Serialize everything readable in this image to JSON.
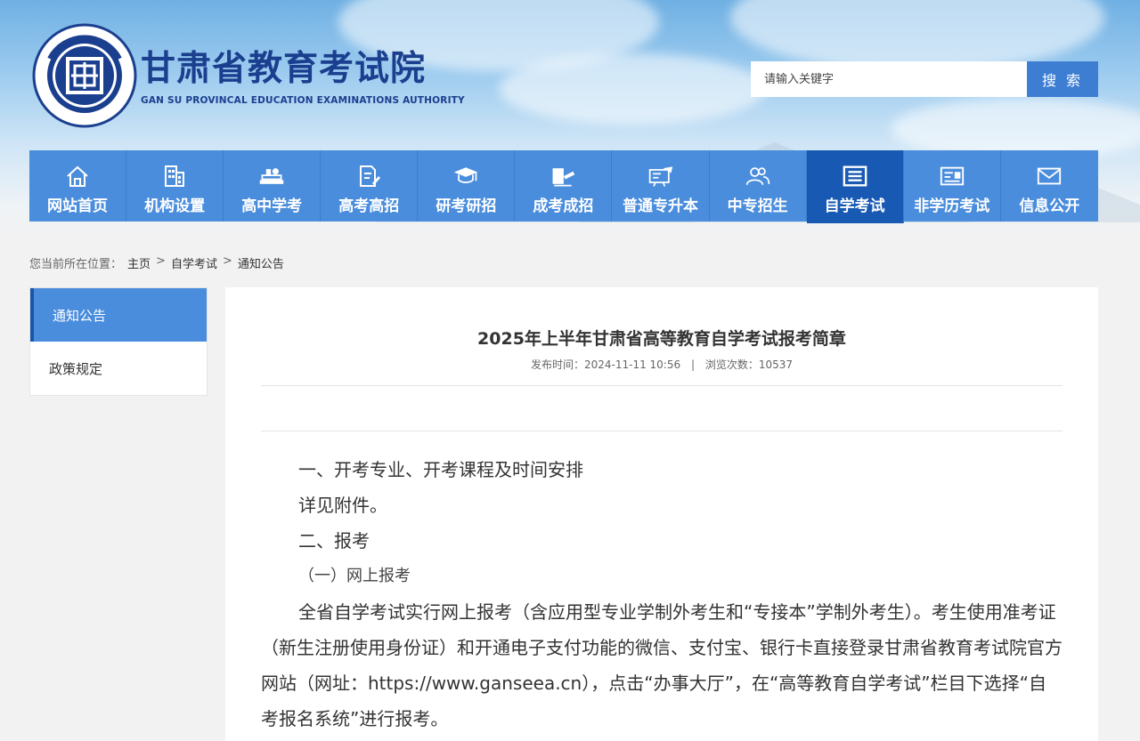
{
  "header": {
    "logo_text": "甘肃省教育考试院",
    "title_cn": "甘肃省教育考试院",
    "title_en": "GAN SU PROVINCAL EDUCATION EXAMINATIONS AUTHORITY"
  },
  "search": {
    "placeholder": "请输入关键字",
    "button_label": "搜 索"
  },
  "nav": {
    "items": [
      {
        "label": "网站首页",
        "icon": "home-icon"
      },
      {
        "label": "机构设置",
        "icon": "building-icon"
      },
      {
        "label": "高中学考",
        "icon": "books-icon"
      },
      {
        "label": "高考高招",
        "icon": "document-pen-icon"
      },
      {
        "label": "研考研招",
        "icon": "graduation-cap-icon"
      },
      {
        "label": "成考成招",
        "icon": "book-pen-icon"
      },
      {
        "label": "普通专升本",
        "icon": "presentation-icon"
      },
      {
        "label": "中专招生",
        "icon": "users-icon"
      },
      {
        "label": "自学考试",
        "icon": "list-doc-icon"
      },
      {
        "label": "非学历考试",
        "icon": "id-card-icon"
      },
      {
        "label": "信息公开",
        "icon": "envelope-icon"
      }
    ],
    "active_index": 8
  },
  "breadcrumb": {
    "prefix": "您当前所在位置：",
    "items": [
      "主页",
      "自学考试",
      "通知公告"
    ],
    "separator": ">"
  },
  "sidebar": {
    "items": [
      "通知公告",
      "政策规定"
    ]
  },
  "article": {
    "title": "2025年上半年甘肃省高等教育自学考试报考简章",
    "meta_time_label": "发布时间：2024-11-11 10:56",
    "meta_sep": "|",
    "meta_views_label": "浏览次数：10537",
    "paragraphs": [
      "一、开考专业、开考课程及时间安排",
      "详见附件。",
      "二、报考",
      "（一）网上报考",
      "全省自学考试实行网上报考（含应用型专业学制外考生和“专接本”学制外考生）。考生使用准考证（新生注册使用身份证）和开通电子支付功能的微信、支付宝、银行卡直接登录甘肃省教育考试院官方网站（网址：https://www.ganseea.cn），点击“办事大厅”，在“高等教育自学考试”栏目下选择“自考报名系统”进行报考。"
    ]
  },
  "colors": {
    "nav_bg": "#4a8ddc",
    "nav_active": "#1859b3",
    "brand": "#1b3f8f"
  }
}
